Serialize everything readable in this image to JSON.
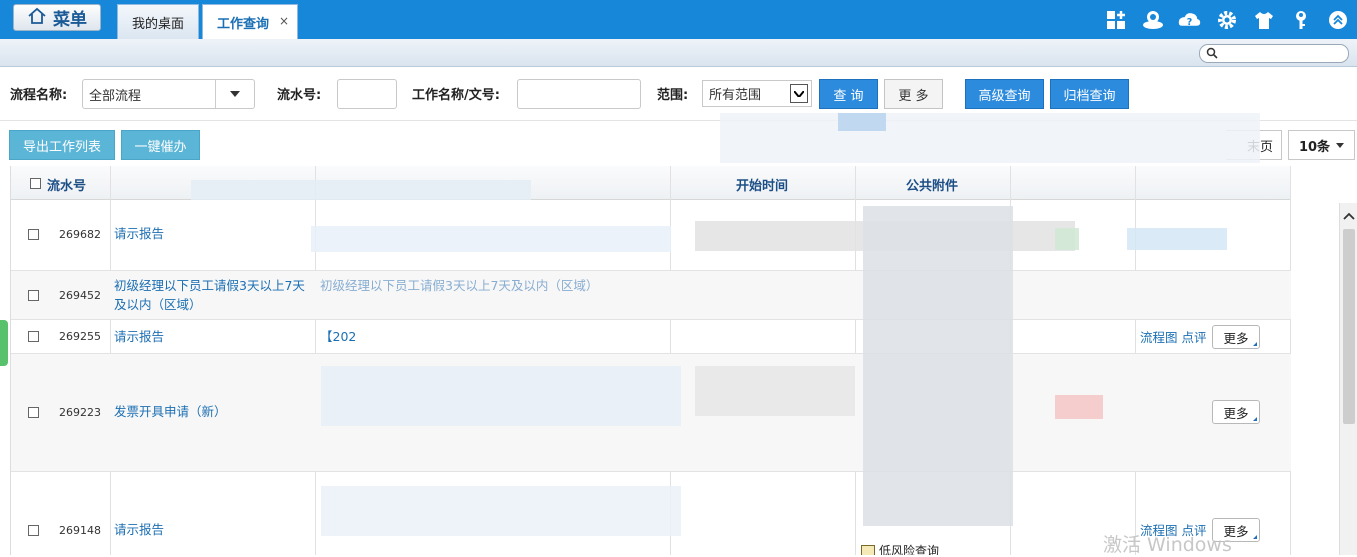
{
  "topbar": {
    "menu_label": "菜单",
    "tabs": [
      {
        "label": "我的桌面"
      },
      {
        "label": "工作查询",
        "close": "×"
      }
    ],
    "icons": [
      "add-app-icon",
      "user-icon",
      "help-icon",
      "settings-icon",
      "shirt-theme-icon",
      "key-icon",
      "collapse-up-icon"
    ]
  },
  "search": {
    "placeholder": ""
  },
  "filters": {
    "flow_name_label": "流程名称:",
    "flow_name_value": "全部流程",
    "serial_label": "流水号:",
    "serial_value": "",
    "work_name_label": "工作名称/文号:",
    "work_name_value": "",
    "scope_label": "范围:",
    "scope_value": "所有范围",
    "query_btn": "查 询",
    "more_btn": "更 多",
    "advanced_btn": "高级查询",
    "archive_btn": "归档查询"
  },
  "actions": {
    "export_btn": "导出工作列表",
    "urge_btn": "一键催办",
    "last_page_btn": "末页",
    "page_size_btn": "10条"
  },
  "table": {
    "headers": {
      "serial": "流水号",
      "start_time": "开始时间",
      "attachments": "公共附件"
    },
    "rows": [
      {
        "serial": "269682",
        "flow": "请示报告"
      },
      {
        "serial": "269452",
        "flow": "初级经理以下员工请假3天以上7天及以内（区域）",
        "work_name": "初级经理以下员工请假3天以上7天及以内（区域）"
      },
      {
        "serial": "269255",
        "flow": "请示报告",
        "work_name": "【202",
        "op_flowchart": "流程图",
        "op_comment": "点评",
        "more": "更多"
      },
      {
        "serial": "269223",
        "flow": "发票开具申请（新）",
        "more": "更多"
      },
      {
        "serial": "269148",
        "flow": "请示报告",
        "attachment": "低风险查询",
        "op_flowchart": "流程图",
        "op_comment": "点评",
        "more": "更多"
      }
    ]
  },
  "watermark": "激活 Windows",
  "colors": {
    "topbar": "#1787d9",
    "link": "#1c6fb3",
    "primary_btn": "#2d8bde",
    "teal_btn": "#5bb5d6"
  }
}
